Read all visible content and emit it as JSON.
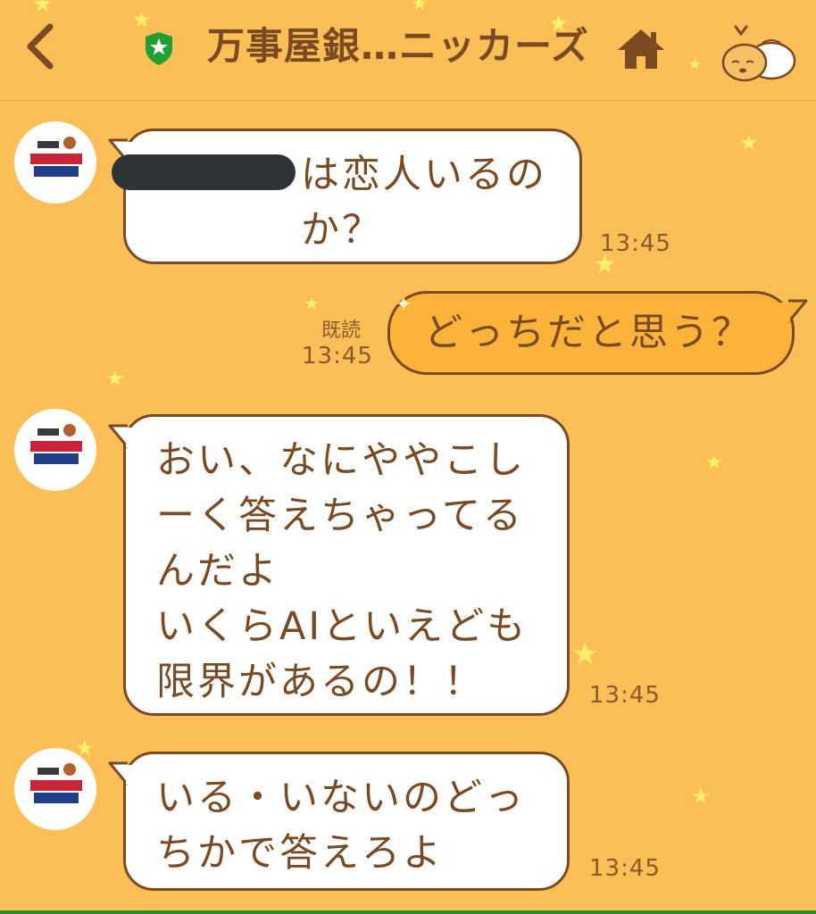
{
  "header": {
    "title": "万事屋銀…ニッカーズ",
    "back_icon": "chevron-left-icon",
    "verified_icon": "green-shield-star-icon",
    "home_icon": "home-icon",
    "mascot_icon": "sleeping-mascot-icon"
  },
  "colors": {
    "background": "#fcbe56",
    "text": "#7a4a22",
    "incoming_bubble": "#ffffff",
    "outgoing_bubble": "#fbb33a",
    "shield": "#20a030",
    "redaction": "#2e3438"
  },
  "messages": [
    {
      "direction": "incoming",
      "sender_avatar": "万事屋銀ちゃん AI彼氏 logo",
      "text": "は恋人いるの\nか？",
      "redacted_prefix": true,
      "time": "13:45"
    },
    {
      "direction": "outgoing",
      "text": "どっちだと思う？",
      "read_label": "既読",
      "time": "13:45"
    },
    {
      "direction": "incoming",
      "sender_avatar": "万事屋銀ちゃん AI彼氏 logo",
      "text": "おい、なにややこし\nーく答えちゃってる\nんだよ\nいくらAIといえども\n限界があるの！！",
      "time": "13:45"
    },
    {
      "direction": "incoming",
      "sender_avatar": "万事屋銀ちゃん AI彼氏 logo",
      "text": "いる・いないのどっ\nちかで答えろよ",
      "time": "13:45"
    }
  ]
}
